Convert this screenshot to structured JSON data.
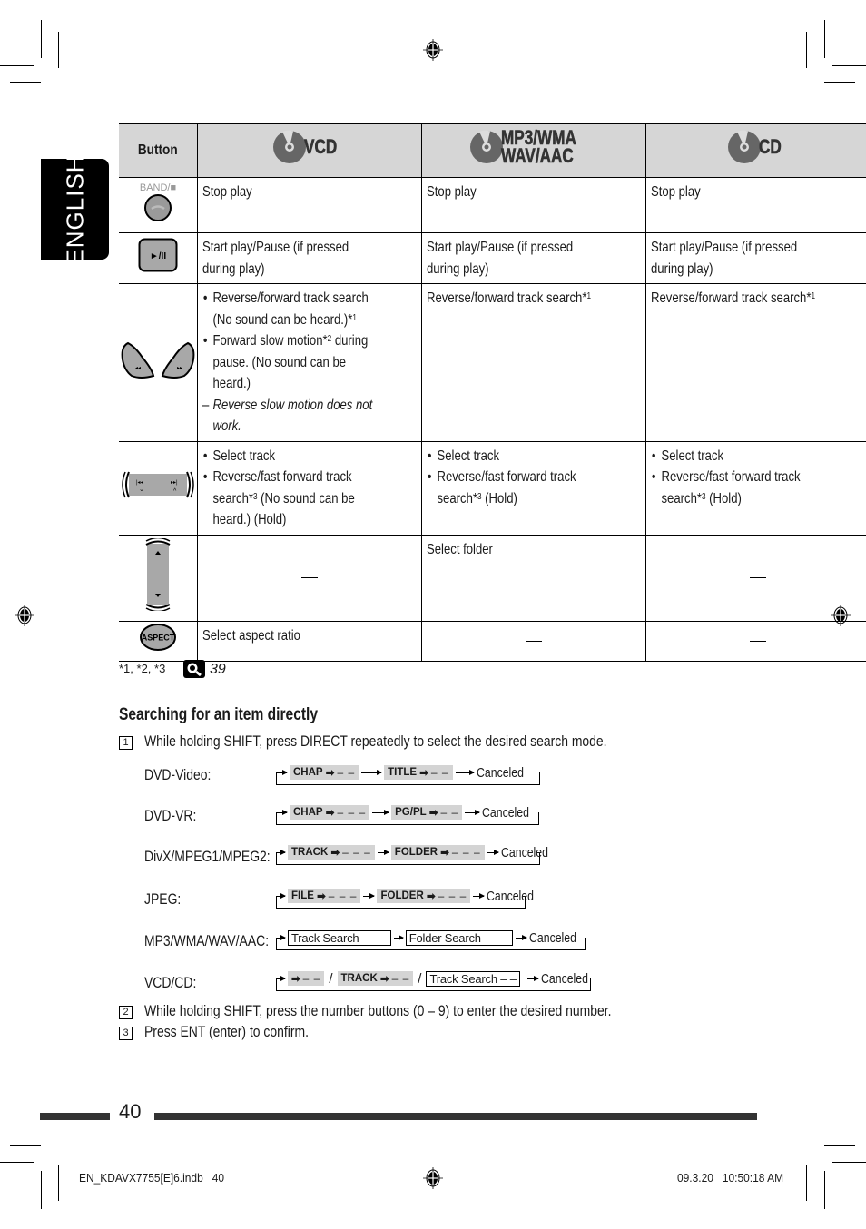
{
  "side_tab": {
    "label": "ENGLISH"
  },
  "table": {
    "header": {
      "button": "Button",
      "columns": [
        {
          "icon": "vcd-disc-icon",
          "label": "VCD"
        },
        {
          "icon": "mp3-disc-icon",
          "label_line1": "MP3/WMA",
          "label_line2": "WAV/AAC"
        },
        {
          "icon": "cd-disc-icon",
          "label": "CD"
        }
      ]
    },
    "rows": [
      {
        "button": {
          "icon": "band-stop-button-icon",
          "caption": "BAND/■"
        },
        "vcd": "Stop play",
        "mp3": "Stop play",
        "cd": "Stop play"
      },
      {
        "button": {
          "icon": "play-pause-button-icon",
          "caption": "►/II"
        },
        "vcd": "Start play/Pause (if pressed during play)",
        "mp3": "Start play/Pause (if pressed during play)",
        "cd": "Start play/Pause (if pressed during play)"
      },
      {
        "button": {
          "icon": "reverse-forward-buttons-icon"
        },
        "vcd": {
          "bullets": [
            {
              "text": "Reverse/forward track search (No sound can be heard.)*",
              "sup": "1"
            },
            {
              "text": "Forward slow motion*",
              "sup": "2",
              "text2": " during pause. (No sound can be heard.)"
            }
          ],
          "note": "Reverse slow motion does not work."
        },
        "mp3": {
          "text": "Reverse/forward track search*",
          "sup": "1"
        },
        "cd": {
          "text": "Reverse/forward track search*",
          "sup": "1"
        }
      },
      {
        "button": {
          "icon": "skip-prev-next-buttons-icon"
        },
        "vcd": {
          "bullets": [
            "Select track"
          ],
          "b2_pre": "Reverse/fast forward track search*",
          "b2_sup": "3",
          "b2_post": " (No sound can be heard.) (Hold)"
        },
        "mp3": {
          "bullets": [
            "Select track"
          ],
          "b2_pre": "Reverse/fast forward track search*",
          "b2_sup": "3",
          "b2_post": " (Hold)"
        },
        "cd": {
          "bullets": [
            "Select track"
          ],
          "b2_pre": "Reverse/fast forward track search*",
          "b2_sup": "3",
          "b2_post": " (Hold)"
        }
      },
      {
        "button": {
          "icon": "up-down-buttons-icon"
        },
        "vcd": "—",
        "mp3": "Select folder",
        "cd": "—"
      },
      {
        "button": {
          "icon": "aspect-button-icon",
          "caption": "ASPECT"
        },
        "vcd": "Select aspect ratio",
        "mp3": "—",
        "cd": "—"
      }
    ]
  },
  "footnote": {
    "marks": "*1, *2, *3",
    "ref_icon": "magnifier-reference-icon",
    "ref_page": "39"
  },
  "section": {
    "title": "Searching for an item directly",
    "steps": [
      {
        "num": "1",
        "text": "While holding SHIFT, press DIRECT repeatedly to select the desired search mode."
      },
      {
        "num": "2",
        "text": "While holding SHIFT, press the number buttons (0 – 9) to enter the desired number."
      },
      {
        "num": "3",
        "text": "Press ENT (enter) to confirm."
      }
    ],
    "modes": [
      {
        "label": "DVD-Video:",
        "items": [
          {
            "box": "CHAP",
            "dash": "– –"
          },
          {
            "box": "TITLE",
            "dash": "– –"
          }
        ],
        "end": "Canceled"
      },
      {
        "label": "DVD-VR:",
        "items": [
          {
            "box": "CHAP",
            "dash": "– – –"
          },
          {
            "box": "PG/PL",
            "dash": "– –"
          }
        ],
        "end": "Canceled"
      },
      {
        "label": "DivX/MPEG1/MPEG2:",
        "items": [
          {
            "box": "TRACK",
            "dash": "– – –"
          },
          {
            "box": "FOLDER",
            "dash": "– – –"
          }
        ],
        "end": "Canceled"
      },
      {
        "label": "JPEG:",
        "items": [
          {
            "box": "FILE",
            "dash": "– – –"
          },
          {
            "box": "FOLDER",
            "dash": "– – –"
          }
        ],
        "end": "Canceled"
      },
      {
        "label": "MP3/WMA/WAV/AAC:",
        "outlined": [
          "Track Search – – –",
          "Folder Search – – –"
        ],
        "end": "Canceled"
      },
      {
        "label": "VCD/CD:",
        "items": [
          {
            "box": "",
            "dash": "– –"
          },
          {
            "box": "TRACK",
            "dash": "– –"
          }
        ],
        "outlined": [
          "Track Search – –"
        ],
        "separator": "/",
        "end": "Canceled"
      }
    ]
  },
  "footer": {
    "page_number": "40",
    "slug_left": "EN_KDAVX7755[E]6.indb   40",
    "slug_right": "09.3.20   10:50:18 AM"
  },
  "colors": {
    "header_bg": "#d6d6d6",
    "bar": "#333333",
    "tab_bg": "#000000",
    "mode_box": "#d4d4d4"
  }
}
